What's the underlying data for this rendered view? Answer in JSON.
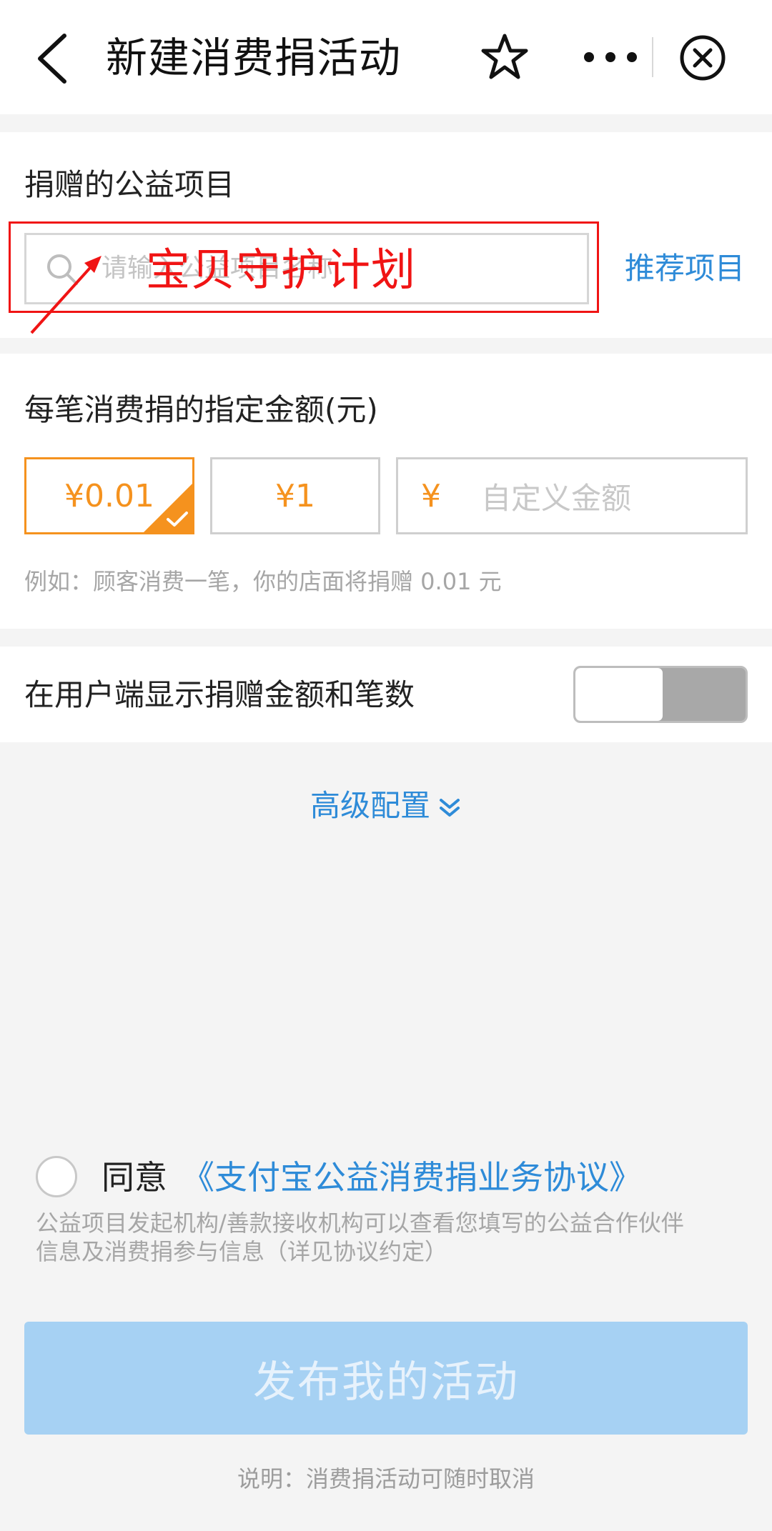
{
  "header": {
    "title": "新建消费捐活动"
  },
  "project": {
    "label": "捐赠的公益项目",
    "search_placeholder": "请输入公益项目名称",
    "annotation": "宝贝守护计划",
    "recommend_label": "推荐项目"
  },
  "amount": {
    "label": "每笔消费捐的指定金额(元)",
    "options": [
      "¥0.01",
      "¥1"
    ],
    "selected_option": "¥0.01",
    "custom_currency": "¥",
    "custom_placeholder": "自定义金额",
    "example": "例如：顾客消费一笔，你的店面将捐赠 0.01 元"
  },
  "display_toggle": {
    "label": "在用户端显示捐赠金额和笔数",
    "enabled": false
  },
  "advanced": {
    "label": "高级配置"
  },
  "agreement": {
    "agree_label": "同意",
    "link_text": "《支付宝公益消费捐业务协议》",
    "notice_line1": "公益项目发起机构/善款接收机构可以查看您填写的公益合作伙伴",
    "notice_line2": "信息及消费捐参与信息（详见协议约定）"
  },
  "publish": {
    "button_label": "发布我的活动",
    "footnote": "说明：消费捐活动可随时取消"
  },
  "colors": {
    "accent_blue": "#2e8bd8",
    "accent_orange": "#f5921e",
    "annotation_red": "#f01414",
    "button_disabled": "#a6d1f3"
  }
}
